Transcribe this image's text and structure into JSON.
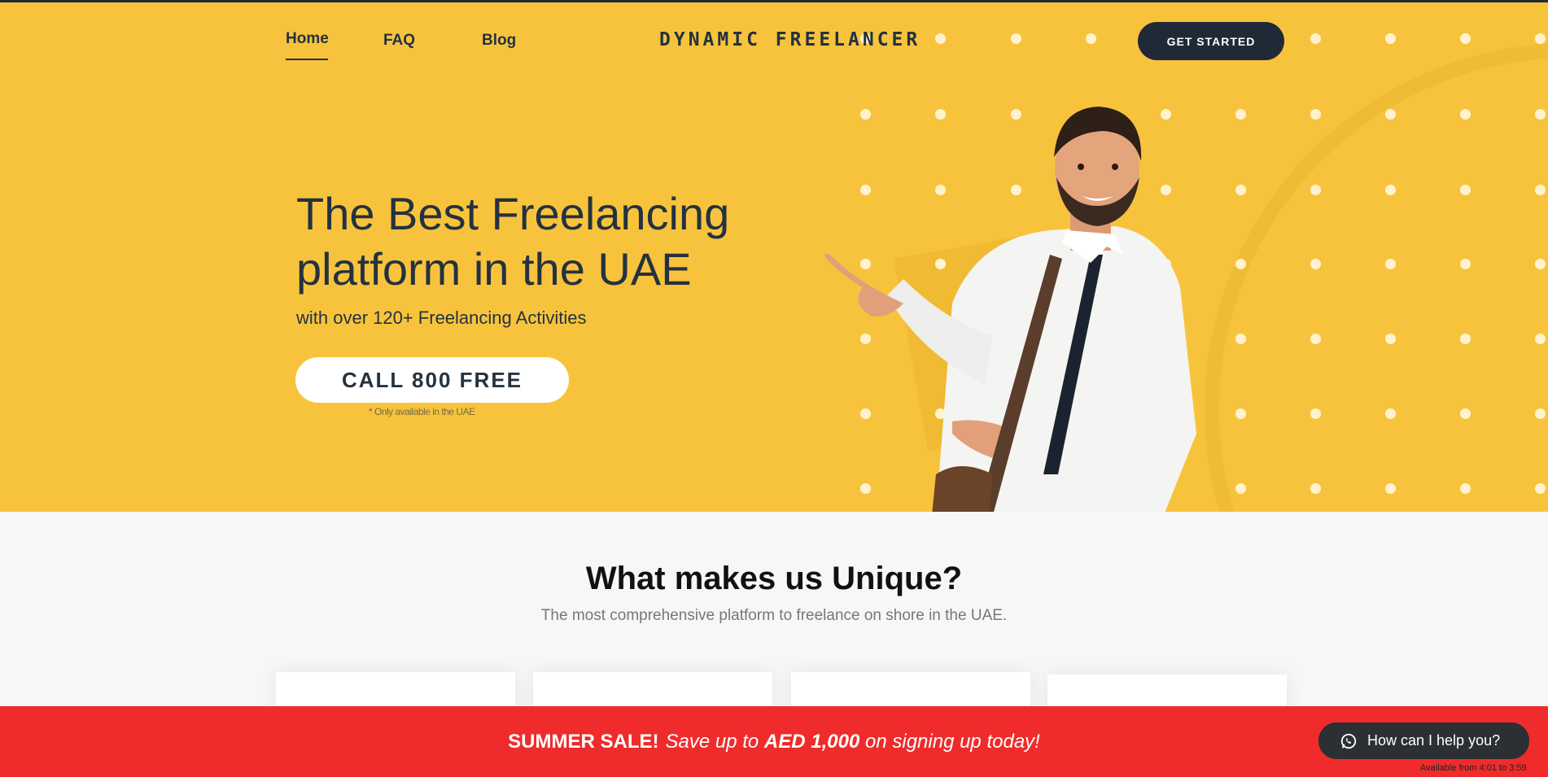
{
  "nav": {
    "home": "Home",
    "faq": "FAQ",
    "blog": "Blog",
    "logo": "DYNAMIC FREELANCER",
    "cta": "GET STARTED"
  },
  "hero": {
    "title": "The Best Freelancing platform in the UAE",
    "subtitle": "with over 120+ Freelancing Activities",
    "call_button": "CALL 800 FREE",
    "note": "* Only available in the UAE"
  },
  "unique": {
    "title": "What makes us Unique?",
    "subtitle": "The most comprehensive platform to freelance on shore in the UAE."
  },
  "banner": {
    "prefix": "SUMMER SALE!",
    "text1": "Save up to",
    "amount": "AED 1,000",
    "text2": "on signing up today!"
  },
  "chat": {
    "label": "How can I help you?",
    "availability": "Available from 4:01 to 3:59"
  },
  "colors": {
    "hero_bg": "#f8c33c",
    "dark": "#1f2a36",
    "banner": "#f02b2b"
  }
}
